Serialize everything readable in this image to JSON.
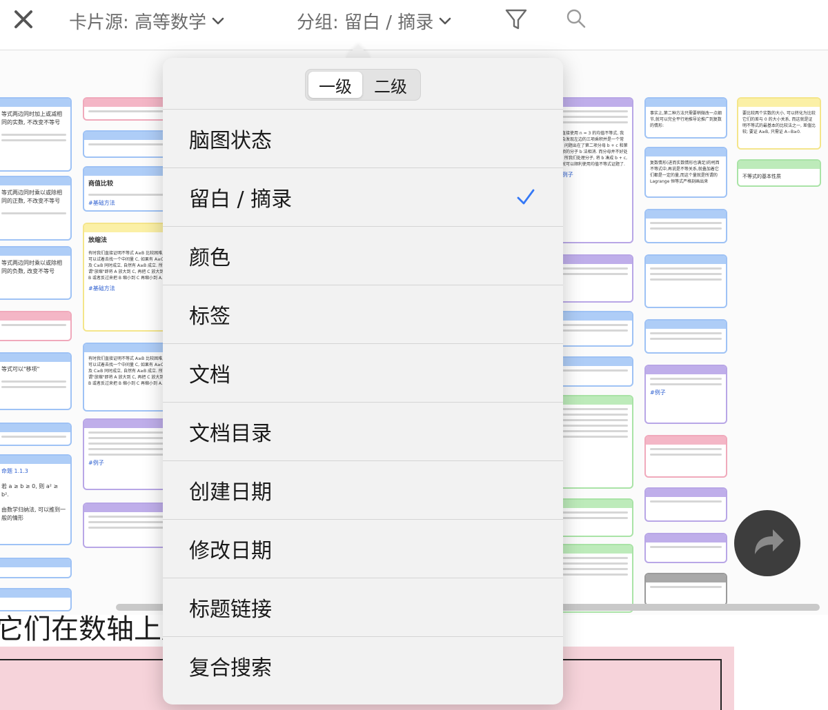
{
  "toolbar": {
    "close_icon": "close-icon",
    "card_source_label": "卡片源: 高等数学",
    "group_label": "分组: 留白 / 摘录",
    "filter_icon": "filter-icon",
    "search_icon": "search-icon"
  },
  "popover": {
    "segments": [
      "一级",
      "二级"
    ],
    "selected_segment": "一级",
    "items": [
      {
        "label": "脑图状态",
        "checked": false
      },
      {
        "label": "留白 / 摘录",
        "checked": true
      },
      {
        "label": "颜色",
        "checked": false
      },
      {
        "label": "标签",
        "checked": false
      },
      {
        "label": "文档",
        "checked": false
      },
      {
        "label": "文档目录",
        "checked": false
      },
      {
        "label": "创建日期",
        "checked": false
      },
      {
        "label": "修改日期",
        "checked": false
      },
      {
        "label": "标题链接",
        "checked": false
      },
      {
        "label": "复合搜索",
        "checked": false
      }
    ],
    "check_color": "#3478f6"
  },
  "cards": {
    "c1": "等式两边同时加上或减相同的实数, 不改变不等号",
    "c2": "等式两边同时乘以或除相同的正数, 不改变不等号",
    "c3": "等式两边同时乘以或除相同的负数, 改变不等号",
    "c4": "等式可以\"移项\"",
    "c5": "商值比较",
    "c6": "#基础方法",
    "c7": "放缩法",
    "c8": "有时我们直接证明不等式 A≥B 比较困难, 可以试着去找一个中间量 C, 如果有 A≥C 及 C≥B 同时成立, 自然有 A≥B 成立. 所谓\"放缩\"即将 A 放大到 C, 再把 C 放大到 B 或者反过来把 B 缩小到 C 再缩小到 A.",
    "c9": "#基础方法",
    "c10": "有时我们直接证明不等式 A≥B 比较困难, 可以试着去找一个中间量 C, 如果有 A≥C 及 C≥B 同时成立, 自然有 A≥B 成立. 所谓\"放缩\"即将 A 放大到 C, 再把 C 放大到 B 或者反过来把 B 缩小到 C 再缩小到 A.",
    "c11": "#例子",
    "c12": "事实上,第二种方法只需要稍微改一点细节,就可以完全平行地推导论推广到复数的情形:",
    "c13": "要比较两个实数的大小, 可以转化为比较它们的差与 0 的大小关系, 而这就是证明不等式的最基本的比较法之一, 差值比较; 要证 A≥B, 只需证 A−B≥0.",
    "c14": "不等式的基本性质",
    "c15": "复数情形(进而实数情形也满足)的柯西不等式中,再说是不等关系,就叠加着它们都是一定的量,而这个量就是所谓的 Lagrange 恒等式严格刻画出来",
    "c16": "#例子",
    "c17": "显直接使用 n = 3 的均值不等式, 我们会发现左边的三项乘积并是一个常数. 问题出在了第二项分母 b + c 和第三项的分子 b 法相消. 而分母并不好处理, 所我们处理分子, 将 b 凑成 b + c, 后就可以顺利使用均值不等式证题了.",
    "c18": "#例子",
    "c19": "命题 1.1.3",
    "c20": "若 a ≥ b ≥ 0, 则 a² ≥ b².",
    "c21": "由数学归纳法, 可以推到一般的情形"
  },
  "bottom_text": "它们在数轴上所"
}
